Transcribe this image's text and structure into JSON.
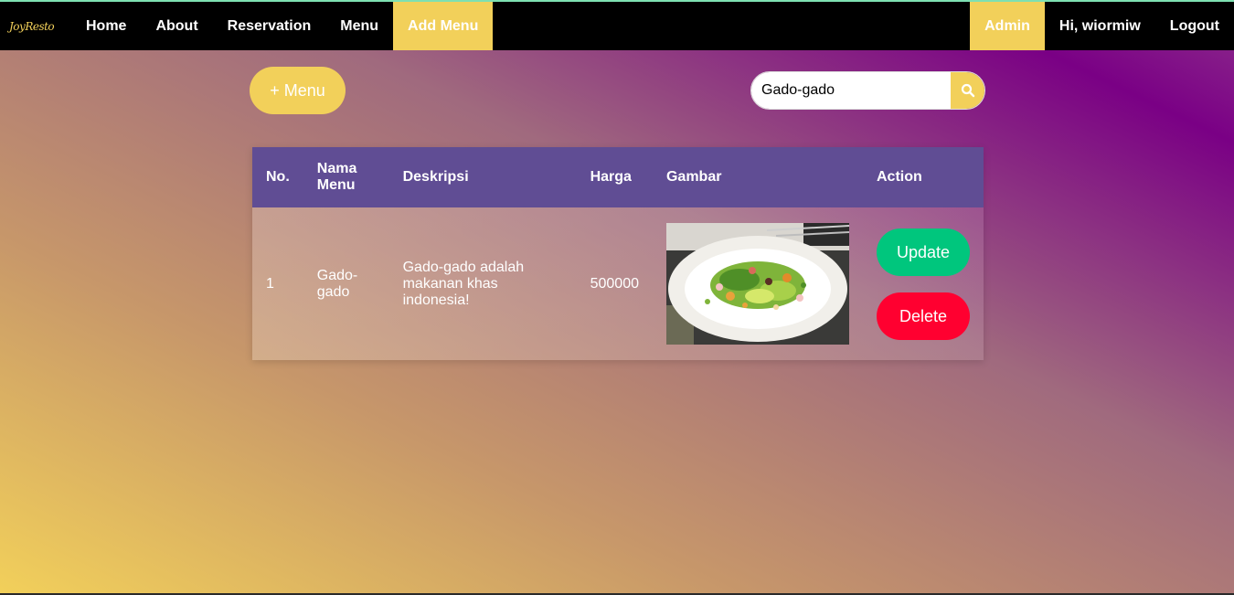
{
  "navbar": {
    "brand": "JoyResto",
    "left_items": [
      "Home",
      "About",
      "Reservation",
      "Menu",
      "Add Menu"
    ],
    "active_item": "Add Menu",
    "right_items": {
      "role": "Admin",
      "greeting": "Hi, wiormiw",
      "logout": "Logout"
    }
  },
  "toolbar": {
    "add_label": "+ Menu",
    "search_value": "Gado-gado",
    "search_icon": "search-icon"
  },
  "table": {
    "headers": [
      "No.",
      "Nama Menu",
      "Deskripsi",
      "Harga",
      "Gambar",
      "Action"
    ],
    "rows": [
      {
        "no": "1",
        "nama": "Gado-gado",
        "deskripsi": "Gado-gado adalah makanan khas indonesia!",
        "harga": "500000",
        "gambar": "salad-plate-photo",
        "update_label": "Update",
        "delete_label": "Delete"
      }
    ]
  },
  "colors": {
    "accent": "#f2d05a",
    "header_bg": "#604d94",
    "update": "#00c67d",
    "delete": "#ff0030",
    "nav_bg": "#000000"
  }
}
